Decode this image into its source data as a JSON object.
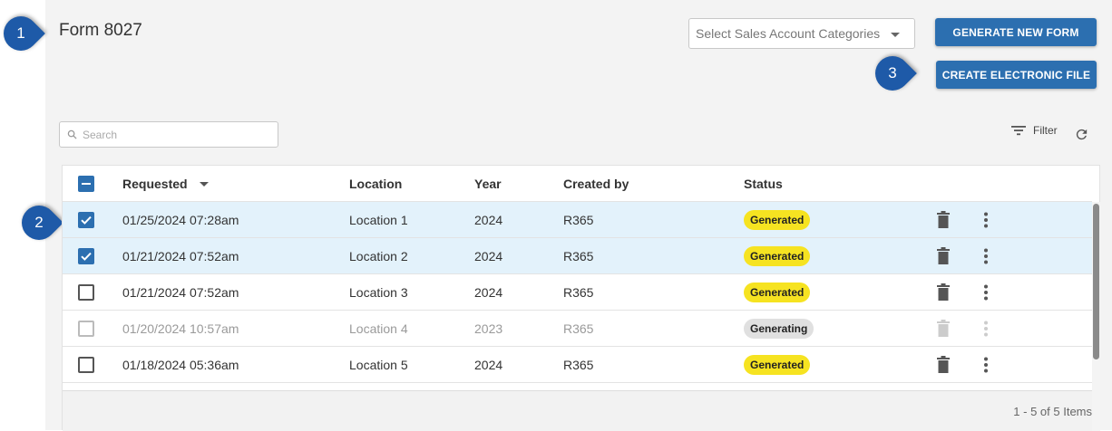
{
  "page": {
    "title": "Form 8027"
  },
  "callouts": [
    "1",
    "2",
    "3"
  ],
  "toolbar": {
    "category_select": "Select Sales Account Categories",
    "generate_label": "GENERATE NEW FORM",
    "create_file_label": "CREATE ELECTRONIC FILE",
    "search_placeholder": "Search",
    "filter_label": "Filter"
  },
  "table": {
    "headers": {
      "requested": "Requested",
      "location": "Location",
      "year": "Year",
      "created_by": "Created by",
      "status": "Status"
    },
    "rows": [
      {
        "requested": "01/25/2024 07:28am",
        "location": "Location 1",
        "year": "2024",
        "created_by": "R365",
        "status": "Generated",
        "checked": true
      },
      {
        "requested": "01/21/2024 07:52am",
        "location": "Location 2",
        "year": "2024",
        "created_by": "R365",
        "status": "Generated",
        "checked": true
      },
      {
        "requested": "01/21/2024 07:52am",
        "location": "Location 3",
        "year": "2024",
        "created_by": "R365",
        "status": "Generated",
        "checked": false
      },
      {
        "requested": "01/20/2024 10:57am",
        "location": "Location 4",
        "year": "2023",
        "created_by": "R365",
        "status": "Generating",
        "checked": false
      },
      {
        "requested": "01/18/2024 05:36am",
        "location": "Location 5",
        "year": "2024",
        "created_by": "R365",
        "status": "Generated",
        "checked": false
      }
    ],
    "pager": "1 - 5 of 5 Items"
  },
  "colors": {
    "primary": "#2c6fb0",
    "callout": "#1e5aa8",
    "generated_badge": "#f6e321",
    "generating_badge": "#e0e0e0",
    "selected_row": "#e3f2fb"
  },
  "icons": [
    "search-icon",
    "filter-icon",
    "refresh-icon",
    "chevron-down-icon",
    "check-icon",
    "minus-icon",
    "trash-icon",
    "more-vertical-icon"
  ]
}
